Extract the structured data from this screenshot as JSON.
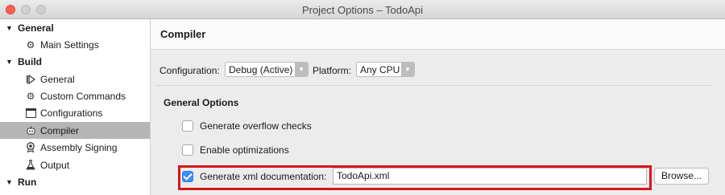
{
  "window": {
    "title": "Project Options – TodoApi"
  },
  "sidebar": {
    "groups": [
      {
        "label": "General",
        "items": [
          {
            "label": "Main Settings",
            "icon": "gear-icon"
          }
        ]
      },
      {
        "label": "Build",
        "items": [
          {
            "label": "General",
            "icon": "play-bar-icon"
          },
          {
            "label": "Custom Commands",
            "icon": "gear-icon"
          },
          {
            "label": "Configurations",
            "icon": "window-icon"
          },
          {
            "label": "Compiler",
            "icon": "robot-icon",
            "selected": true
          },
          {
            "label": "Assembly Signing",
            "icon": "seal-icon"
          },
          {
            "label": "Output",
            "icon": "flask-icon"
          }
        ]
      },
      {
        "label": "Run",
        "items": []
      }
    ]
  },
  "main": {
    "header_title": "Compiler",
    "configuration": {
      "label": "Configuration:",
      "value": "Debug (Active)"
    },
    "platform": {
      "label": "Platform:",
      "value": "Any CPU"
    },
    "section_title": "General Options",
    "options": [
      {
        "label": "Generate overflow checks",
        "checked": false
      },
      {
        "label": "Enable optimizations",
        "checked": false
      },
      {
        "label": "Generate xml documentation:",
        "checked": true
      }
    ],
    "xml_doc_value": "TodoApi.xml",
    "browse_label": "Browse..."
  },
  "colors": {
    "highlight": "#d8141c",
    "selected_row": "#b5b5b5",
    "checkbox_on": "#3b8ef5"
  }
}
